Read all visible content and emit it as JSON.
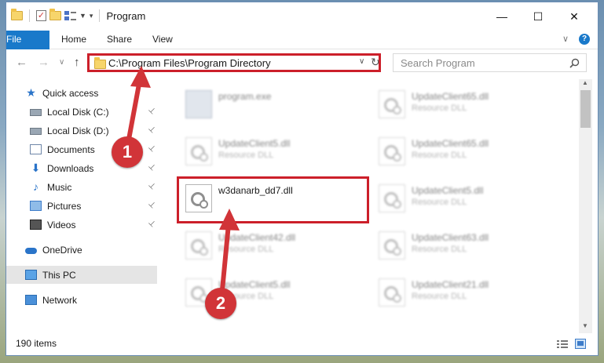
{
  "window": {
    "title": "Program",
    "controls": {
      "minimize": "—",
      "maximize": "☐",
      "close": "✕"
    }
  },
  "ribbon": {
    "tabs": [
      "File",
      "Home",
      "Share",
      "View"
    ],
    "expand_glyph": "∨",
    "help_glyph": "?"
  },
  "address": {
    "path": "C:\\Program Files\\Program Directory",
    "dropdown_glyph": "∨",
    "refresh_glyph": "↻"
  },
  "search": {
    "placeholder": "Search Program",
    "icon": "search-icon"
  },
  "nav": {
    "back": "←",
    "forward": "→",
    "recent": "∨",
    "up": "↑"
  },
  "sidebar": {
    "items": [
      {
        "label": "Quick access",
        "icon": "star-icon"
      },
      {
        "label": "Local Disk (C:)",
        "icon": "drive-icon",
        "pinned": true
      },
      {
        "label": "Local Disk (D:)",
        "icon": "drive-icon",
        "pinned": true
      },
      {
        "label": "Documents",
        "icon": "documents-icon",
        "pinned": true
      },
      {
        "label": "Downloads",
        "icon": "download-icon",
        "pinned": true
      },
      {
        "label": "Music",
        "icon": "music-icon",
        "pinned": true
      },
      {
        "label": "Pictures",
        "icon": "pictures-icon",
        "pinned": true
      },
      {
        "label": "Videos",
        "icon": "videos-icon",
        "pinned": true
      },
      {
        "label": "OneDrive",
        "icon": "cloud-icon"
      },
      {
        "label": "This PC",
        "icon": "computer-icon",
        "selected": true
      },
      {
        "label": "Network",
        "icon": "network-icon"
      }
    ],
    "pin_glyph": "📌"
  },
  "files": {
    "left": [
      {
        "name": "program.exe",
        "sub": ""
      },
      {
        "name": "UpdateClient5.dll",
        "sub": "Resource DLL"
      },
      {
        "name": "w3danarb_dd7.dll",
        "sub": ""
      },
      {
        "name": "UpdateClient42.dll",
        "sub": "Resource DLL"
      },
      {
        "name": "UpdateClient5.dll",
        "sub": "Resource DLL"
      }
    ],
    "right": [
      {
        "name": "UpdateClient65.dll",
        "sub": "Resource DLL"
      },
      {
        "name": "UpdateClient65.dll",
        "sub": "Resource DLL"
      },
      {
        "name": "UpdateClient5.dll",
        "sub": "Resource DLL"
      },
      {
        "name": "UpdateClient63.dll",
        "sub": "Resource DLL"
      },
      {
        "name": "UpdateClient21.dll",
        "sub": "Resource DLL"
      }
    ]
  },
  "status": {
    "items_count": "190 items"
  },
  "annotations": {
    "marker1": "1",
    "marker2": "2",
    "color": "#d13438",
    "highlight_color": "#cc1f2a"
  },
  "colors": {
    "file_tab": "#1979ca",
    "selected": "#e5e5e5"
  }
}
